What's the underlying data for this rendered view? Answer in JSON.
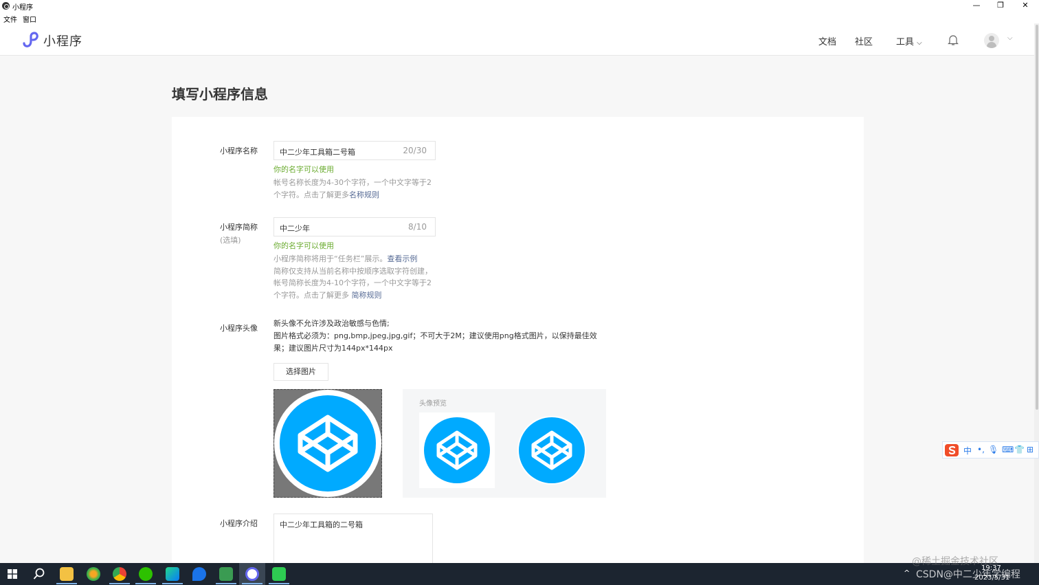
{
  "window": {
    "title": "小程序",
    "minimize": "—",
    "restore": "❐",
    "close": "✕"
  },
  "menubar": {
    "items": [
      "文件",
      "窗口"
    ]
  },
  "header": {
    "logo_text": "小程序",
    "nav": [
      "文档",
      "社区",
      "工具"
    ],
    "tools_caret": "⌵",
    "avatar_caret": "⌵"
  },
  "page": {
    "title": "填写小程序信息"
  },
  "form": {
    "name": {
      "label": "小程序名称",
      "value": "中二少年工具箱二号箱",
      "count": "20/30",
      "ok": "你的名字可以使用",
      "tip1": "帐号名称长度为4-30个字符，一个中文字等于2",
      "tip2_prefix": "个字符。点击了解更多",
      "tip2_link": "名称规则"
    },
    "short": {
      "label": "小程序简称",
      "sublabel": "(选填)",
      "value": "中二少年",
      "count": "8/10",
      "ok": "你的名字可以使用",
      "tip1_prefix": "小程序简称将用于“任务栏”展示。",
      "tip1_link": "查看示例",
      "tip2": "简称仅支持从当前名称中按顺序选取字符创建，",
      "tip3": "帐号简称长度为4-10个字符，一个中文字等于2",
      "tip4_prefix": "个字符。点击了解更多 ",
      "tip4_link": "简称规则"
    },
    "avatar": {
      "label": "小程序头像",
      "desc1": "新头像不允许涉及政治敏感与色情;",
      "desc2": "图片格式必须为：png,bmp,jpeg,jpg,gif；不可大于2M；建议使用png格式图片，以保持最佳效",
      "desc3": "果；建议图片尺寸为144px*144px",
      "choose_button": "选择图片",
      "preview_title": "头像预览"
    },
    "intro": {
      "label": "小程序介绍",
      "value": "中二少年工具箱的二号箱"
    }
  },
  "ime": {
    "items": [
      "中",
      "•,",
      "🎙",
      "⌨",
      "👕",
      "⊞"
    ]
  },
  "taskbar": {
    "tray_caret": "^",
    "clock_time": "19:37",
    "clock_date": "2023/5/31",
    "watermark1": "@稀土掘金技术社区",
    "watermark2": "CSDN@中二少年学编程"
  },
  "colors": {
    "accent": "#576b95",
    "success": "#6aab2f",
    "logo": "#6467f0",
    "codepen_blue": "#00aaff",
    "taskbar": "#1c2530"
  }
}
